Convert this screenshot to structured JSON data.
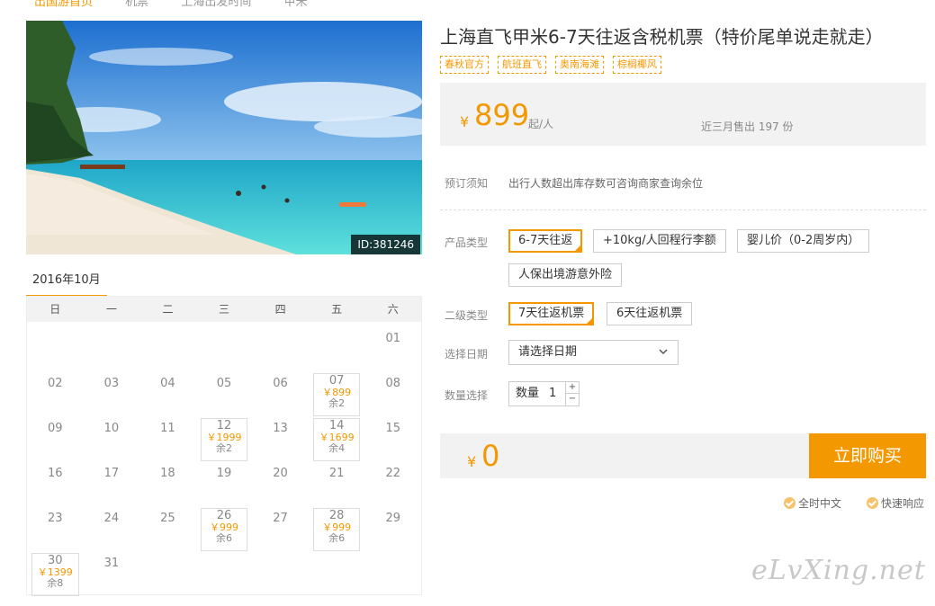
{
  "breadcrumb": {
    "items": [
      "出国游首页",
      "机票",
      "上海出发时间",
      "甲米"
    ]
  },
  "product": {
    "image_id": "ID:381246",
    "title": "上海直飞甲米6-7天往返含税机票（特价尾单说走就走）",
    "tags": [
      "春秋官方",
      "航班直飞",
      "奥南海滩",
      "棕榈椰风"
    ],
    "price": {
      "currency": "¥",
      "amount": "899",
      "unit": "起/人",
      "sold": "近三月售出 197 份"
    }
  },
  "calendar": {
    "month": "2016年10月",
    "weekdays": [
      "日",
      "一",
      "二",
      "三",
      "四",
      "五",
      "六"
    ],
    "cells": [
      {
        "day": ""
      },
      {
        "day": ""
      },
      {
        "day": ""
      },
      {
        "day": ""
      },
      {
        "day": ""
      },
      {
        "day": ""
      },
      {
        "day": "01"
      },
      {
        "day": "02"
      },
      {
        "day": "03"
      },
      {
        "day": "04"
      },
      {
        "day": "05"
      },
      {
        "day": "06"
      },
      {
        "day": "07",
        "price": "￥899",
        "stock": "余2"
      },
      {
        "day": "08"
      },
      {
        "day": "09"
      },
      {
        "day": "10"
      },
      {
        "day": "11"
      },
      {
        "day": "12",
        "price": "￥1999",
        "stock": "余2"
      },
      {
        "day": "13"
      },
      {
        "day": "14",
        "price": "￥1699",
        "stock": "余4"
      },
      {
        "day": "15"
      },
      {
        "day": "16"
      },
      {
        "day": "17"
      },
      {
        "day": "18"
      },
      {
        "day": "19"
      },
      {
        "day": "20"
      },
      {
        "day": "21"
      },
      {
        "day": "22"
      },
      {
        "day": "23"
      },
      {
        "day": "24"
      },
      {
        "day": "25"
      },
      {
        "day": "26",
        "price": "￥999",
        "stock": "余6"
      },
      {
        "day": "27"
      },
      {
        "day": "28",
        "price": "￥999",
        "stock": "余6"
      },
      {
        "day": "29"
      },
      {
        "day": "30",
        "price": "￥1399",
        "stock": "余8"
      },
      {
        "day": "31"
      }
    ]
  },
  "booking": {
    "notice_label": "预订须知",
    "notice_text": "出行人数超出库存数可咨询商家查询余位",
    "product_type_label": "产品类型",
    "product_types": [
      "6-7天往返",
      "+10kg/人回程行李额",
      "婴儿价（0-2周岁内）",
      "人保出境游意外险"
    ],
    "sub_type_label": "二级类型",
    "sub_types": [
      "7天往返机票",
      "6天往返机票"
    ],
    "date_label": "选择日期",
    "date_placeholder": "请选择日期",
    "qty_label": "数量选择",
    "qty_text": "数量",
    "qty_value": "1",
    "qty_plus": "+",
    "qty_minus": "−",
    "total_currency": "¥",
    "total": "0",
    "buy_label": "立即购买",
    "badges": [
      "全时中文",
      "快速响应"
    ]
  },
  "watermark": "eLvXing.net",
  "colors": {
    "accent": "#f39800",
    "panel": "#f2f2f2"
  }
}
